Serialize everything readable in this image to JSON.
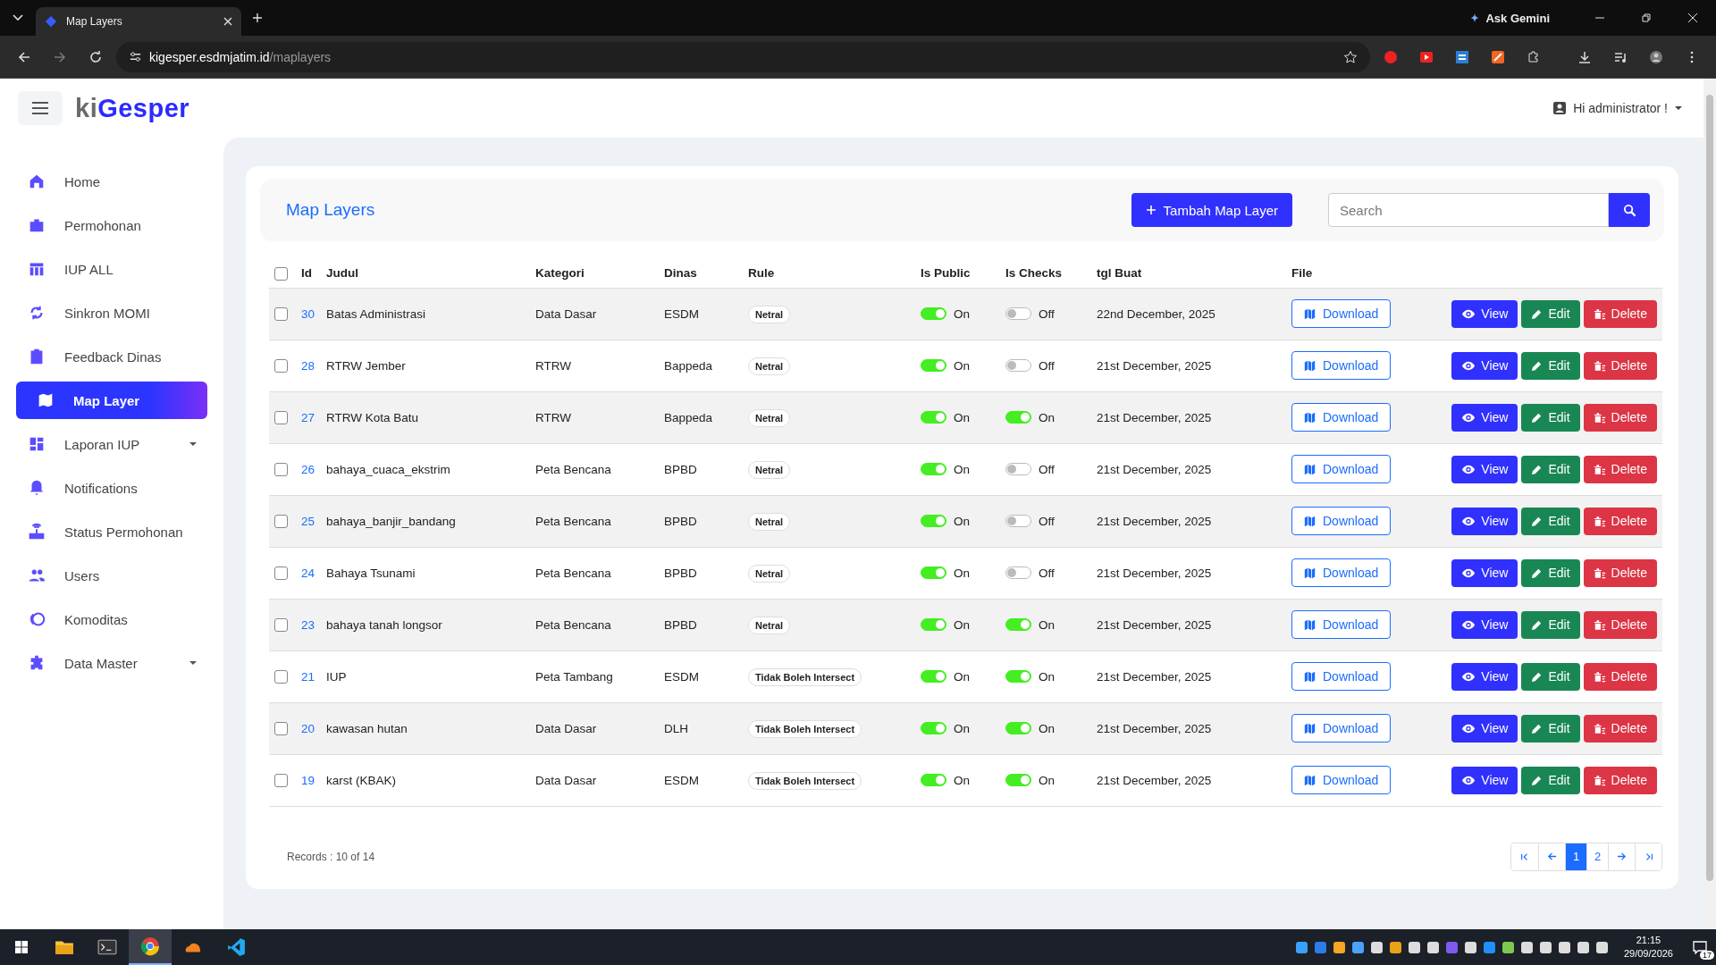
{
  "browser": {
    "tab_title": "Map Layers",
    "url_host": "kigesper.esdmjatim.id",
    "url_path": "/maplayers",
    "gemini": "Ask Gemini"
  },
  "logo": {
    "prefix": "ki",
    "name": "Gesper"
  },
  "user_menu": "Hi administrator !",
  "sidebar": {
    "items": [
      {
        "label": "Home",
        "selected": false,
        "has_submenu": false
      },
      {
        "label": "Permohonan",
        "selected": false,
        "has_submenu": false
      },
      {
        "label": "IUP ALL",
        "selected": false,
        "has_submenu": false
      },
      {
        "label": "Sinkron MOMI",
        "selected": false,
        "has_submenu": false
      },
      {
        "label": "Feedback Dinas",
        "selected": false,
        "has_submenu": false
      },
      {
        "label": "Map Layer",
        "selected": true,
        "has_submenu": false
      },
      {
        "label": "Laporan IUP",
        "selected": false,
        "has_submenu": true
      },
      {
        "label": "Notifications",
        "selected": false,
        "has_submenu": false
      },
      {
        "label": "Status Permohonan",
        "selected": false,
        "has_submenu": false
      },
      {
        "label": "Users",
        "selected": false,
        "has_submenu": false
      },
      {
        "label": "Komoditas",
        "selected": false,
        "has_submenu": false
      },
      {
        "label": "Data Master",
        "selected": false,
        "has_submenu": true
      }
    ]
  },
  "page_title": "Map Layers",
  "add_button": "Tambah Map Layer",
  "search": {
    "placeholder": "Search"
  },
  "table": {
    "select_all_checked": false,
    "columns": [
      "Id",
      "Judul",
      "Kategori",
      "Dinas",
      "Rule",
      "Is Public",
      "Is Checks",
      "tgl Buat",
      "File"
    ],
    "rows": [
      {
        "checked": false,
        "id": "30",
        "judul": "Batas Administrasi",
        "kategori": "Data Dasar",
        "dinas": "ESDM",
        "rule": "Netral",
        "is_public": {
          "on": true,
          "label": "On"
        },
        "is_checks": {
          "on": false,
          "label": "Off"
        },
        "tgl_buat": "22nd December, 2025",
        "file": "Download",
        "actions": [
          "View",
          "Edit",
          "Delete"
        ]
      },
      {
        "checked": false,
        "id": "28",
        "judul": "RTRW Jember",
        "kategori": "RTRW",
        "dinas": "Bappeda",
        "rule": "Netral",
        "is_public": {
          "on": true,
          "label": "On"
        },
        "is_checks": {
          "on": false,
          "label": "Off"
        },
        "tgl_buat": "21st December, 2025",
        "file": "Download",
        "actions": [
          "View",
          "Edit",
          "Delete"
        ]
      },
      {
        "checked": false,
        "id": "27",
        "judul": "RTRW Kota Batu",
        "kategori": "RTRW",
        "dinas": "Bappeda",
        "rule": "Netral",
        "is_public": {
          "on": true,
          "label": "On"
        },
        "is_checks": {
          "on": true,
          "label": "On"
        },
        "tgl_buat": "21st December, 2025",
        "file": "Download",
        "actions": [
          "View",
          "Edit",
          "Delete"
        ]
      },
      {
        "checked": false,
        "id": "26",
        "judul": "bahaya_cuaca_ekstrim",
        "kategori": "Peta Bencana",
        "dinas": "BPBD",
        "rule": "Netral",
        "is_public": {
          "on": true,
          "label": "On"
        },
        "is_checks": {
          "on": false,
          "label": "Off"
        },
        "tgl_buat": "21st December, 2025",
        "file": "Download",
        "actions": [
          "View",
          "Edit",
          "Delete"
        ]
      },
      {
        "checked": false,
        "id": "25",
        "judul": "bahaya_banjir_bandang",
        "kategori": "Peta Bencana",
        "dinas": "BPBD",
        "rule": "Netral",
        "is_public": {
          "on": true,
          "label": "On"
        },
        "is_checks": {
          "on": false,
          "label": "Off"
        },
        "tgl_buat": "21st December, 2025",
        "file": "Download",
        "actions": [
          "View",
          "Edit",
          "Delete"
        ]
      },
      {
        "checked": false,
        "id": "24",
        "judul": "Bahaya Tsunami",
        "kategori": "Peta Bencana",
        "dinas": "BPBD",
        "rule": "Netral",
        "is_public": {
          "on": true,
          "label": "On"
        },
        "is_checks": {
          "on": false,
          "label": "Off"
        },
        "tgl_buat": "21st December, 2025",
        "file": "Download",
        "actions": [
          "View",
          "Edit",
          "Delete"
        ]
      },
      {
        "checked": false,
        "id": "23",
        "judul": "bahaya tanah longsor",
        "kategori": "Peta Bencana",
        "dinas": "BPBD",
        "rule": "Netral",
        "is_public": {
          "on": true,
          "label": "On"
        },
        "is_checks": {
          "on": true,
          "label": "On"
        },
        "tgl_buat": "21st December, 2025",
        "file": "Download",
        "actions": [
          "View",
          "Edit",
          "Delete"
        ]
      },
      {
        "checked": false,
        "id": "21",
        "judul": "IUP",
        "kategori": "Peta Tambang",
        "dinas": "ESDM",
        "rule": "Tidak Boleh Intersect",
        "is_public": {
          "on": true,
          "label": "On"
        },
        "is_checks": {
          "on": true,
          "label": "On"
        },
        "tgl_buat": "21st December, 2025",
        "file": "Download",
        "actions": [
          "View",
          "Edit",
          "Delete"
        ]
      },
      {
        "checked": false,
        "id": "20",
        "judul": "kawasan hutan",
        "kategori": "Data Dasar",
        "dinas": "DLH",
        "rule": "Tidak Boleh Intersect",
        "is_public": {
          "on": true,
          "label": "On"
        },
        "is_checks": {
          "on": true,
          "label": "On"
        },
        "tgl_buat": "21st December, 2025",
        "file": "Download",
        "actions": [
          "View",
          "Edit",
          "Delete"
        ]
      },
      {
        "checked": false,
        "id": "19",
        "judul": "karst (KBAK)",
        "kategori": "Data Dasar",
        "dinas": "ESDM",
        "rule": "Tidak Boleh Intersect",
        "is_public": {
          "on": true,
          "label": "On"
        },
        "is_checks": {
          "on": true,
          "label": "On"
        },
        "tgl_buat": "21st December, 2025",
        "file": "Download",
        "actions": [
          "View",
          "Edit",
          "Delete"
        ]
      }
    ]
  },
  "records": "Records : 10 of 14",
  "pagination": {
    "pages": [
      {
        "label": "1",
        "selected": true
      },
      {
        "label": "2",
        "selected": false
      }
    ]
  },
  "taskbar": {
    "apps": [
      {
        "selected": false
      },
      {
        "selected": false
      },
      {
        "selected": true
      },
      {
        "selected": false
      },
      {
        "selected": false
      }
    ],
    "time": "21:15",
    "date": "29/09/2026",
    "notifications": "17"
  }
}
